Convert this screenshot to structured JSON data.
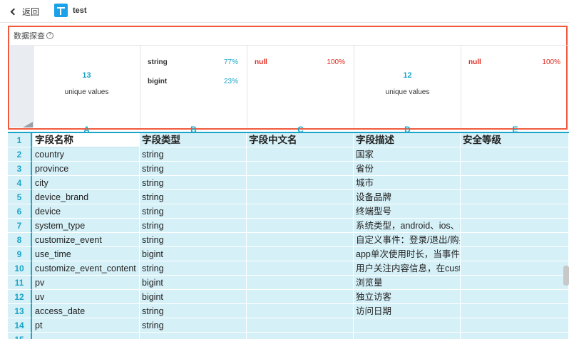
{
  "topbar": {
    "back_label": "返回",
    "app_title": "test"
  },
  "profile": {
    "title": "数据探查",
    "columns": [
      {
        "letter": "A",
        "kind": "unique",
        "count": "13",
        "sub": "unique values"
      },
      {
        "letter": "B",
        "kind": "types",
        "rows": [
          {
            "type": "string",
            "pct": "77%"
          },
          {
            "type": "bigint",
            "pct": "23%"
          }
        ]
      },
      {
        "letter": "C",
        "kind": "null",
        "rows": [
          {
            "type": "null",
            "pct": "100%"
          }
        ]
      },
      {
        "letter": "D",
        "kind": "unique",
        "count": "12",
        "sub": "unique values"
      },
      {
        "letter": "E",
        "kind": "null",
        "rows": [
          {
            "type": "null",
            "pct": "100%"
          }
        ]
      }
    ]
  },
  "table": {
    "headers": [
      "字段名称",
      "字段类型",
      "字段中文名",
      "字段描述",
      "安全等级"
    ],
    "rows": [
      {
        "num": "2",
        "cells": [
          "country",
          "string",
          "",
          "国家",
          ""
        ]
      },
      {
        "num": "3",
        "cells": [
          "province",
          "string",
          "",
          "省份",
          ""
        ]
      },
      {
        "num": "4",
        "cells": [
          "city",
          "string",
          "",
          "城市",
          ""
        ]
      },
      {
        "num": "5",
        "cells": [
          "device_brand",
          "string",
          "",
          "设备品牌",
          ""
        ]
      },
      {
        "num": "6",
        "cells": [
          "device",
          "string",
          "",
          "终端型号",
          ""
        ]
      },
      {
        "num": "7",
        "cells": [
          "system_type",
          "string",
          "",
          "系统类型，android、ios、ipad、windows_phone",
          ""
        ]
      },
      {
        "num": "8",
        "cells": [
          "customize_event",
          "string",
          "",
          "自定义事件：登录/退出/购买/注册/点击/后台/",
          ""
        ]
      },
      {
        "num": "9",
        "cells": [
          "use_time",
          "bigint",
          "",
          "app单次使用时长，当事件为退出、后台、切换",
          ""
        ]
      },
      {
        "num": "10",
        "cells": [
          "customize_event_content",
          "string",
          "",
          "用户关注内容信息，在customize_event为浏览利",
          ""
        ]
      },
      {
        "num": "11",
        "cells": [
          "pv",
          "bigint",
          "",
          "浏览量",
          ""
        ]
      },
      {
        "num": "12",
        "cells": [
          "uv",
          "bigint",
          "",
          "独立访客",
          ""
        ]
      },
      {
        "num": "13",
        "cells": [
          "access_date",
          "string",
          "",
          "访问日期",
          ""
        ]
      },
      {
        "num": "14",
        "cells": [
          "pt",
          "string",
          "",
          "",
          ""
        ]
      },
      {
        "num": "15",
        "cells": [
          "",
          "",
          "",
          "",
          ""
        ]
      }
    ],
    "header_row_num": "1"
  },
  "colors": {
    "accent": "#1aa5c9",
    "highlight_border": "#f05a3c",
    "null_red": "#e0281e",
    "grid_bg": "#d5f0f7"
  }
}
